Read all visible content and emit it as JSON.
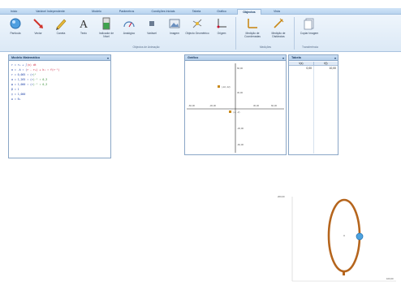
{
  "tabs": [
    "Início",
    "Variável Independente",
    "Modelo",
    "Parâmetros",
    "Condições Iniciais",
    "Tabela",
    "Gráfico",
    "Objectos",
    "Vista"
  ],
  "active_tab": "Objectos",
  "ribbon": {
    "buttons": [
      {
        "label": "Partícula",
        "icon": "particle-icon"
      },
      {
        "label": "Vector",
        "icon": "vector-icon"
      },
      {
        "label": "Caneta",
        "icon": "pen-icon"
      },
      {
        "label": "Texto",
        "icon": "text-icon"
      },
      {
        "label": "Indicador de Nível",
        "icon": "level-indicator-icon"
      },
      {
        "label": "Analógico",
        "icon": "analog-gauge-icon"
      },
      {
        "label": "Variável",
        "icon": "variable-icon"
      },
      {
        "label": "Imagem",
        "icon": "image-icon"
      },
      {
        "label": "Objecto Geométrico",
        "icon": "geometric-object-icon"
      },
      {
        "label": "Origem",
        "icon": "origin-icon"
      },
      {
        "label": "Medição de Coordenadas",
        "icon": "coordinate-measure-icon"
      },
      {
        "label": "Medição de Distâncias",
        "icon": "distance-measure-icon"
      },
      {
        "label": "Copiar Imagem",
        "icon": "copy-image-icon"
      }
    ],
    "groups": [
      "Objectos de Animação",
      "Medições",
      "Transferência"
    ]
  },
  "panels": {
    "model": {
      "title": "Modelo Matemático",
      "lines": [
        {
          "lhs": "r = r₀ + ∫",
          "rest": "(v) dt"
        },
        {
          "lhs": "a = -k ∙ (",
          "rest": "r - r₀) + k₁ ∙ f(r⁻¹)"
        },
        {
          "lhs": "r = 0,005 ∙ (r",
          "rest": ")²"
        },
        {
          "lhs": "α = 1,265 ∙ (r",
          "rest": ")⁻¹ ∙ 0,3"
        },
        {
          "lhs": "φ = 1,000 ∙ (r",
          "rest": ")⁻¹ ∙ 0,3"
        },
        {
          "lhs": "β = 1",
          "rest": ""
        },
        {
          "lhs": "γ = 1,000",
          "rest": ""
        },
        {
          "lhs": "ω = θ₀",
          "rest": ""
        }
      ]
    },
    "graph": {
      "title": "Gráfico",
      "x_ticks": [
        "-60,00",
        "-30,00",
        "0,00",
        "30,00",
        "60,00"
      ],
      "y_ticks": [
        "60,00",
        "30,00",
        "0,00",
        "-30,00",
        "-60,00"
      ],
      "point_labels": [
        "(-10, 22)",
        "(-4, -2)"
      ]
    },
    "table": {
      "title": "Tabela",
      "columns": [
        "t(s)",
        "f(t)"
      ],
      "rows": [
        [
          "0,00",
          "10,00"
        ]
      ]
    }
  },
  "scene": {
    "y_label": "200,00",
    "x_label": "100,00"
  }
}
